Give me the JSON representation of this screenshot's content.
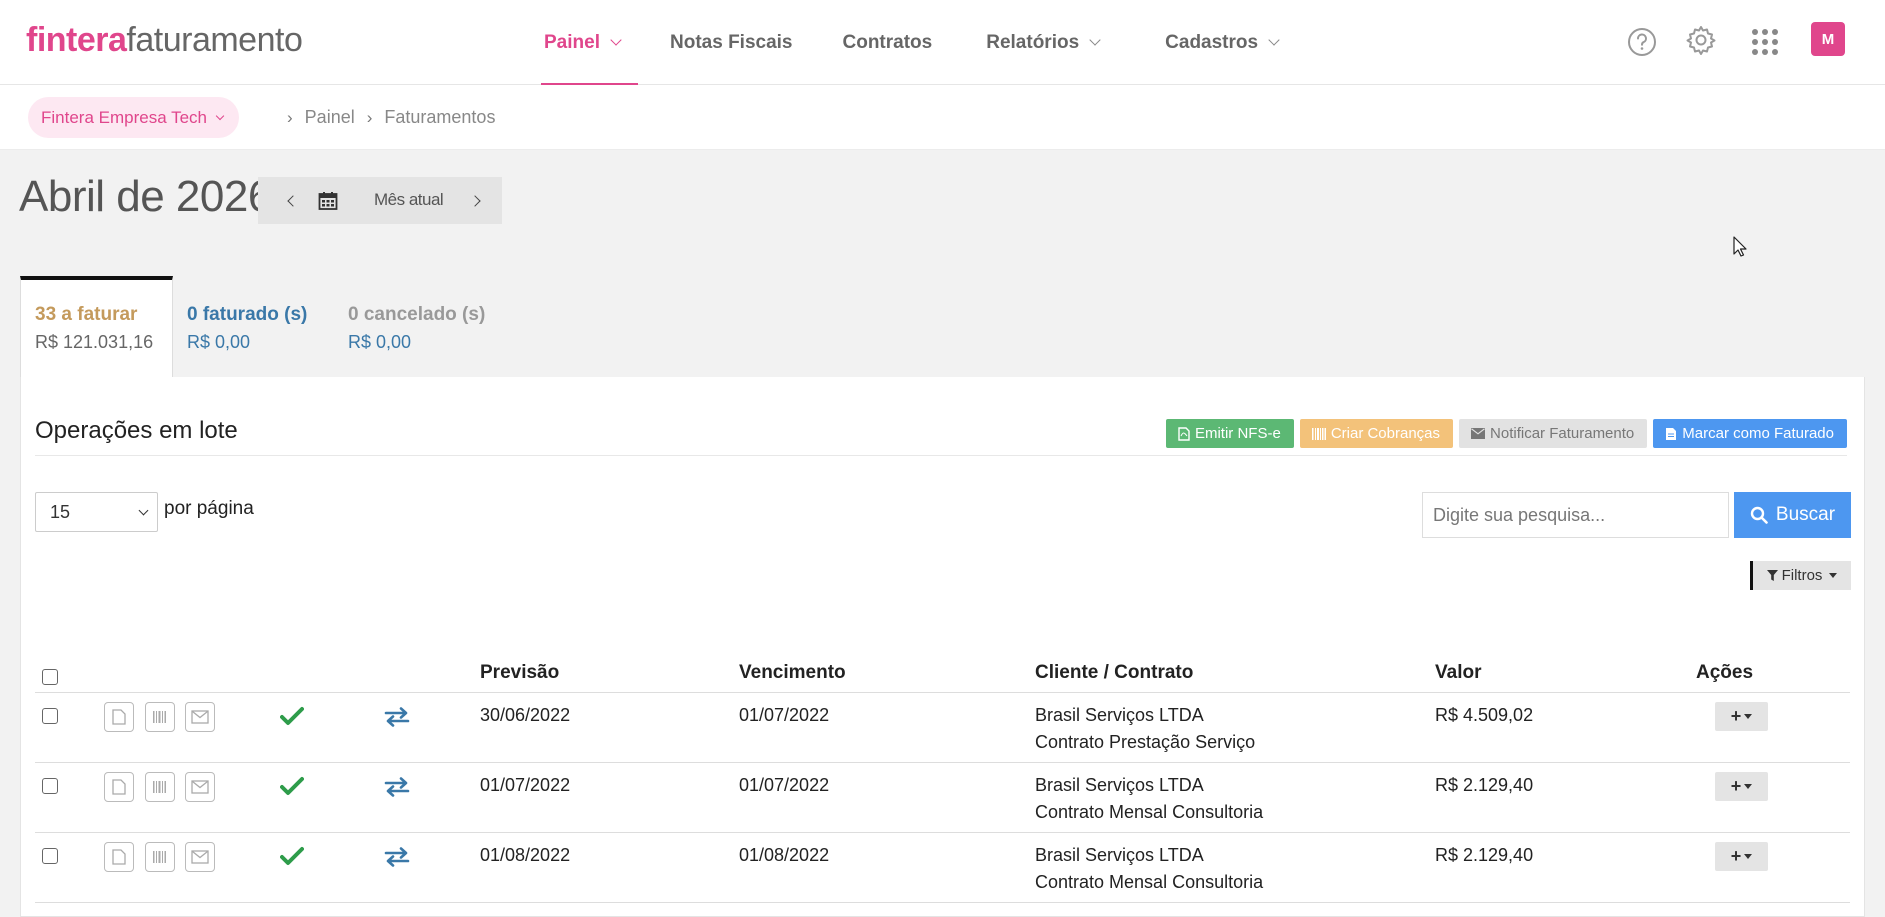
{
  "brand": {
    "part1": "fintera",
    "part2": "faturamento"
  },
  "nav": [
    {
      "label": "Painel"
    },
    {
      "label": "Notas Fiscais"
    },
    {
      "label": "Contratos"
    },
    {
      "label": "Relatórios"
    },
    {
      "label": "Cadastros"
    }
  ],
  "header": {
    "avatar_letter": "M",
    "icons": [
      "help-icon",
      "gear-icon",
      "apps-grid-icon"
    ]
  },
  "colors": {
    "accent": "#e0468c",
    "primary": "#4d97f0",
    "success": "#5cb874",
    "warning": "#f3c27a"
  },
  "breadcrumb": {
    "company": "Fintera Empresa Tech",
    "items": [
      "Painel",
      "Faturamentos"
    ]
  },
  "period": {
    "title": "Abril de 2026",
    "current_label": "Mês atual"
  },
  "tabs": [
    {
      "label": "33 a faturar",
      "amount": "R$ 121.031,16"
    },
    {
      "label": "0 faturado (s)",
      "amount": "R$ 0,00"
    },
    {
      "label": "0 cancelado (s)",
      "amount": "R$ 0,00"
    }
  ],
  "lote": {
    "title": "Operações em lote",
    "buttons": {
      "emitir": "Emitir NFS-e",
      "cobrancas": "Criar Cobranças",
      "notificar": "Notificar Faturamento",
      "marcar": "Marcar como Faturado"
    }
  },
  "listing": {
    "per_page_value": "15",
    "per_page_label": "por página",
    "search_placeholder": "Digite sua pesquisa...",
    "search_button": "Buscar",
    "filters_button": "Filtros"
  },
  "table": {
    "headers": {
      "previsao": "Previsão",
      "vencimento": "Vencimento",
      "cliente": "Cliente / Contrato",
      "valor": "Valor",
      "acoes": "Ações"
    },
    "rows": [
      {
        "previsao": "30/06/2022",
        "vencimento": "01/07/2022",
        "cliente": "Brasil Serviços LTDA",
        "contrato": "Contrato Prestação Serviço",
        "valor": "R$ 4.509,02"
      },
      {
        "previsao": "01/07/2022",
        "vencimento": "01/07/2022",
        "cliente": "Brasil Serviços LTDA",
        "contrato": "Contrato Mensal Consultoria",
        "valor": "R$ 2.129,40"
      },
      {
        "previsao": "01/08/2022",
        "vencimento": "01/08/2022",
        "cliente": "Brasil Serviços LTDA",
        "contrato": "Contrato Mensal Consultoria",
        "valor": "R$ 2.129,40"
      }
    ]
  }
}
